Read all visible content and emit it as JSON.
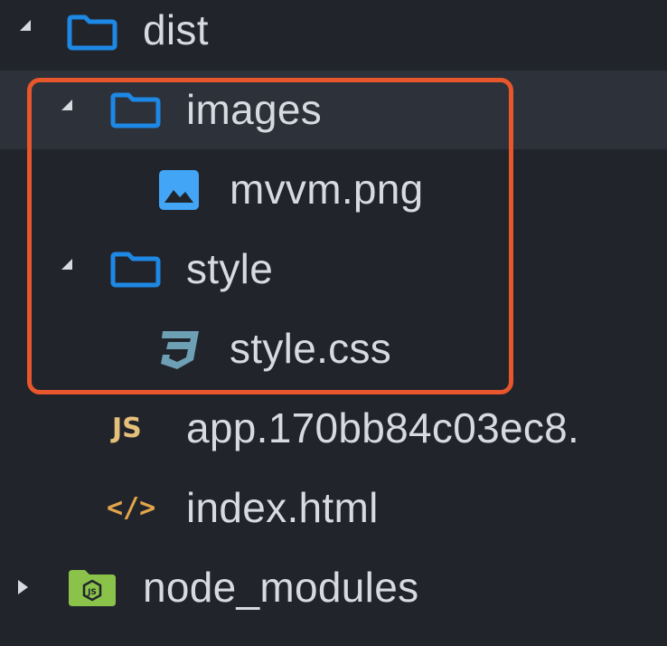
{
  "tree": {
    "items": [
      {
        "label": "dist",
        "kind": "folder",
        "expanded": true
      },
      {
        "label": "images",
        "kind": "folder",
        "expanded": true
      },
      {
        "label": "mvvm.png",
        "kind": "image-file"
      },
      {
        "label": "style",
        "kind": "folder",
        "expanded": true
      },
      {
        "label": "style.css",
        "kind": "css-file"
      },
      {
        "label": "app.170bb84c03ec8.",
        "kind": "js-file",
        "icon_text": "JS"
      },
      {
        "label": "index.html",
        "kind": "html-file",
        "icon_text": "</>"
      },
      {
        "label": "node_modules",
        "kind": "node-folder",
        "expanded": false
      }
    ]
  },
  "colors": {
    "background": "#21252b",
    "selected_row": "#2c313a",
    "folder_icon": "#1e88e5",
    "image_icon": "#42a5f5",
    "css_icon": "#6d9fb5",
    "js_icon": "#e5c07b",
    "html_icon": "#e5a54b",
    "node_icon": "#8bc34a",
    "highlight_border": "#e8562c",
    "text": "#d7dae0"
  }
}
